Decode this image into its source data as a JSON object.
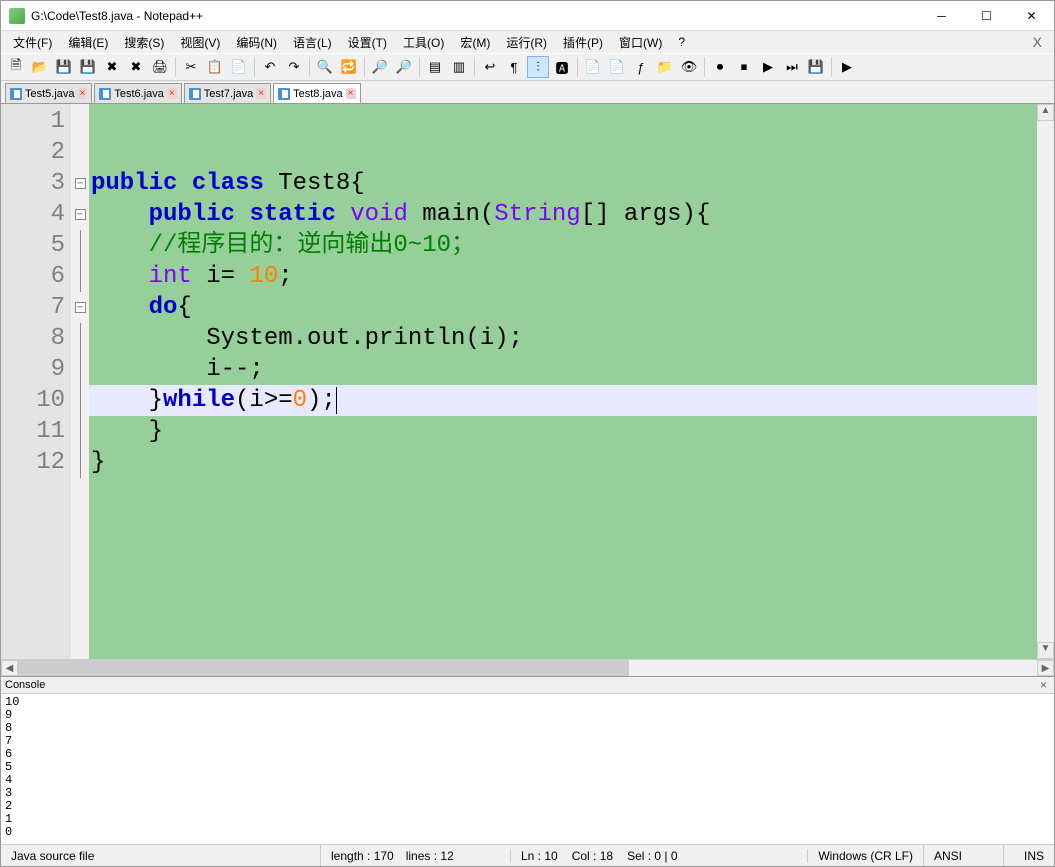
{
  "titlebar": {
    "title": "G:\\Code\\Test8.java - Notepad++"
  },
  "menu": {
    "file": "文件(F)",
    "edit": "编辑(E)",
    "search": "搜索(S)",
    "view": "视图(V)",
    "encoding": "编码(N)",
    "language": "语言(L)",
    "settings": "设置(T)",
    "tools": "工具(O)",
    "macro": "宏(M)",
    "run": "运行(R)",
    "plugins": "插件(P)",
    "window": "窗口(W)",
    "help": "?"
  },
  "tabs": [
    {
      "label": "Test5.java"
    },
    {
      "label": "Test6.java"
    },
    {
      "label": "Test7.java"
    },
    {
      "label": "Test8.java"
    }
  ],
  "code": {
    "lines": [
      "",
      "",
      "public class Test8{",
      "    public static void main(String[] args){",
      "    //程序目的：逆向输出0~10；",
      "    int i= 10;",
      "    do{",
      "        System.out.println(i);",
      "        i--;",
      "    }while(i>=0);",
      "    }",
      "}"
    ],
    "highlighted_line": 10
  },
  "console": {
    "title": "Console",
    "output": [
      "10",
      "9",
      "8",
      "7",
      "6",
      "5",
      "4",
      "3",
      "2",
      "1",
      "0"
    ]
  },
  "status": {
    "filetype": "Java source file",
    "length": "length : 170",
    "lines": "lines : 12",
    "ln": "Ln : 10",
    "col": "Col : 18",
    "sel": "Sel : 0 | 0",
    "eol": "Windows (CR LF)",
    "encoding": "ANSI",
    "mode": "INS"
  }
}
